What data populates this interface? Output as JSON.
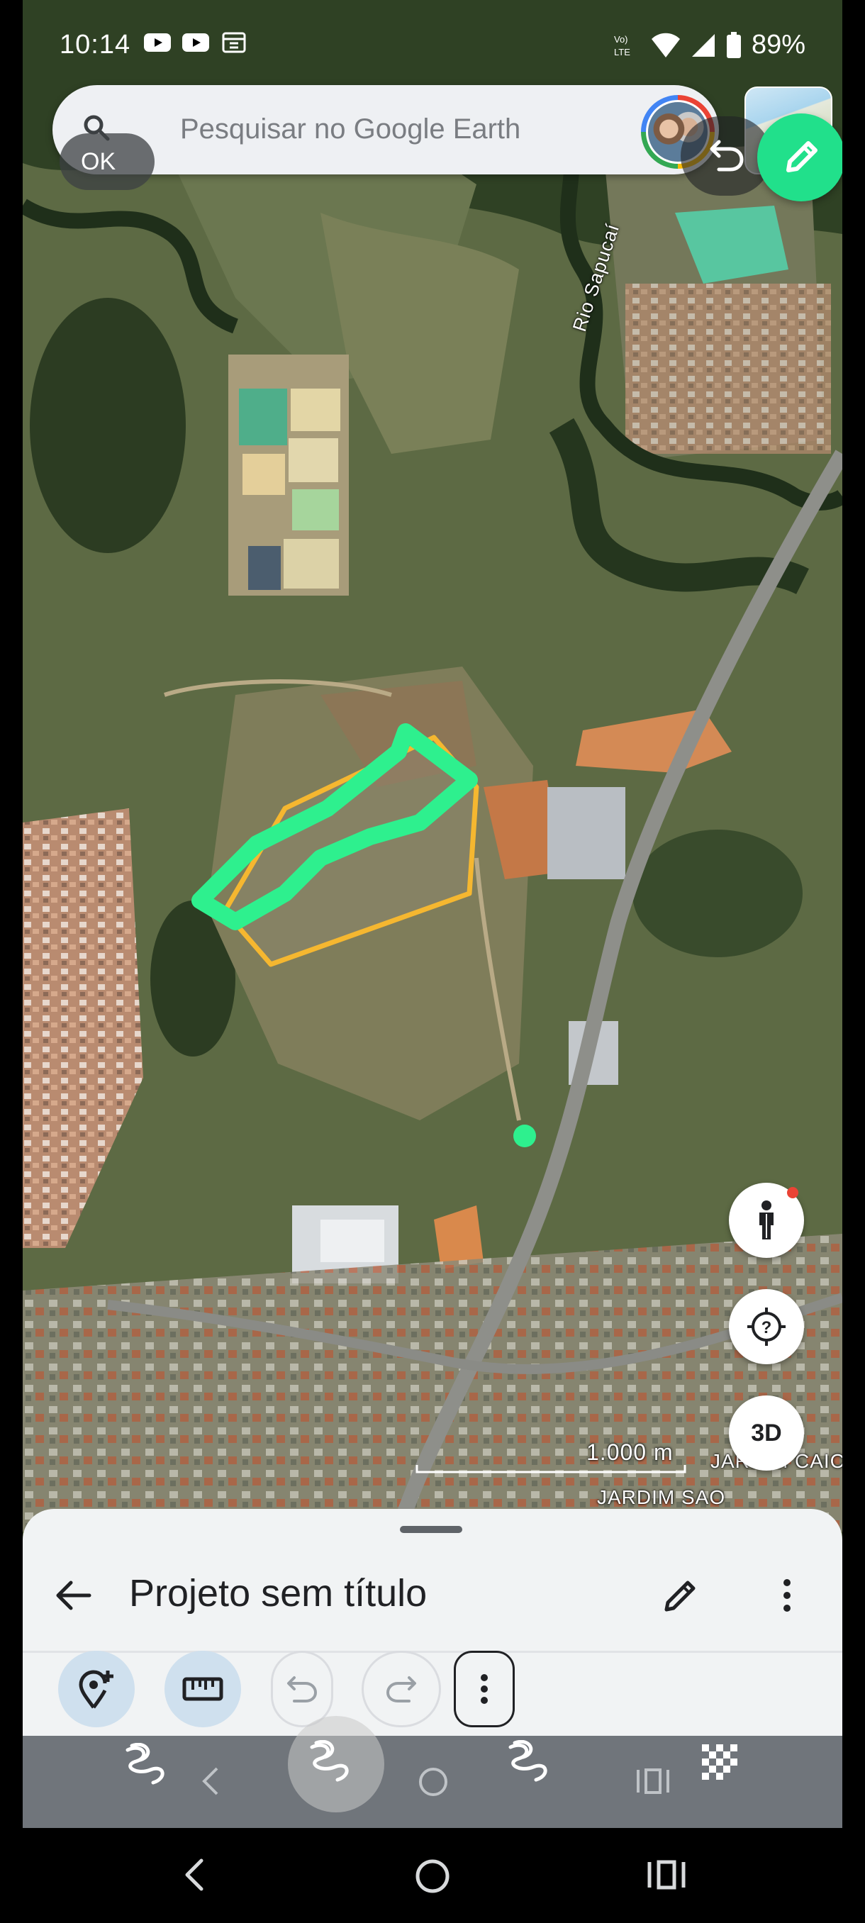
{
  "status_bar": {
    "time": "10:14",
    "battery": "89%",
    "network_label": "Vo) LTE"
  },
  "search": {
    "placeholder": "Pesquisar no Google Earth",
    "ok_label": "OK"
  },
  "map": {
    "river_label": "Rio Sapucaí",
    "scale_label": "1.000 m",
    "place_label_1": "JARDIM CAICA",
    "place_label_2": "JARDIM SAO",
    "polygon_colors": {
      "outline": "#f5b730",
      "drawn_line": "#2ef08e"
    }
  },
  "map_buttons": {
    "pegman_icon": "pegman-icon",
    "locate_icon": "my-location-icon",
    "three_d_label": "3D"
  },
  "sheet": {
    "title": "Projeto sem título"
  },
  "toolbar": {
    "add_place_icon": "add-place-icon",
    "measure_icon": "ruler-icon",
    "undo_icon": "undo-icon",
    "redo_icon": "redo-icon",
    "more_icon": "more-vert-icon"
  },
  "colors": {
    "accent_green": "#21e08b",
    "sheet_bg": "#f1f3f4",
    "tool_active_bg": "#cfe0ee"
  }
}
